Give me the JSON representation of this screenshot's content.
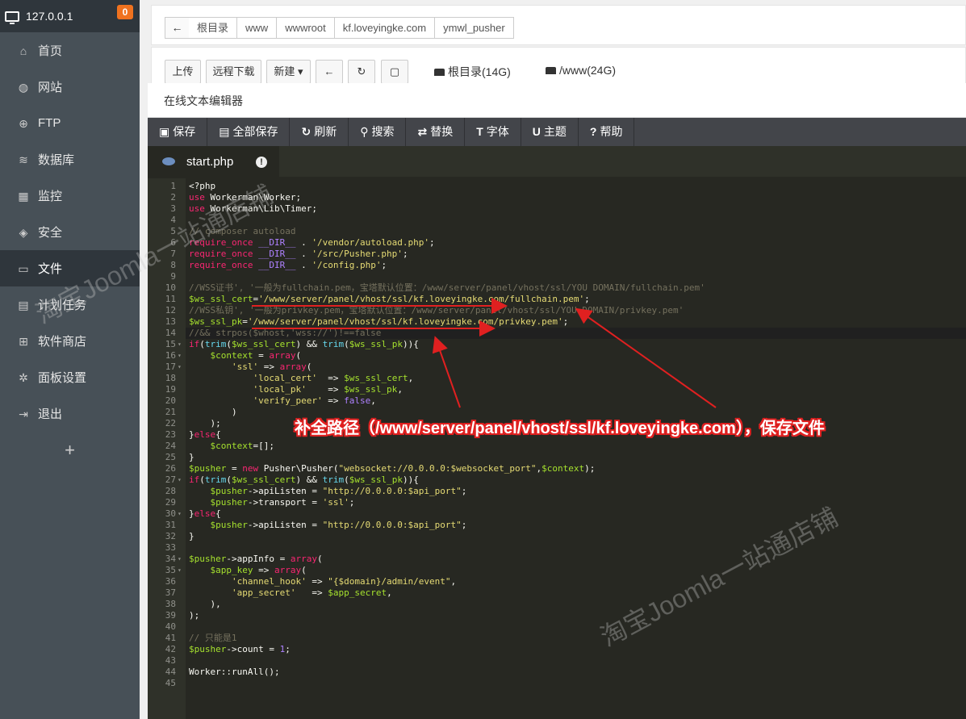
{
  "sidebar": {
    "host": "127.0.0.1",
    "badge": "0",
    "items": [
      {
        "label": "首页",
        "icon": "home-icon"
      },
      {
        "label": "网站",
        "icon": "globe-icon"
      },
      {
        "label": "FTP",
        "icon": "ftp-icon"
      },
      {
        "label": "数据库",
        "icon": "database-icon"
      },
      {
        "label": "监控",
        "icon": "monitor-chart-icon"
      },
      {
        "label": "安全",
        "icon": "shield-icon"
      },
      {
        "label": "文件",
        "icon": "folder-icon"
      },
      {
        "label": "计划任务",
        "icon": "calendar-icon"
      },
      {
        "label": "软件商店",
        "icon": "grid-icon"
      },
      {
        "label": "面板设置",
        "icon": "gear-icon"
      },
      {
        "label": "退出",
        "icon": "logout-icon"
      }
    ],
    "active_index": 6,
    "add": "+"
  },
  "breadcrumb": [
    "根目录",
    "www",
    "wwwroot",
    "kf.loveyingke.com",
    "ymwl_pusher"
  ],
  "toolbar": {
    "upload": "上传",
    "remote_download": "远程下载",
    "new": "新建",
    "disk_root": "根目录(14G)",
    "disk_www": "/www(24G)"
  },
  "editor": {
    "title": "在线文本编辑器",
    "tools": [
      "保存",
      "全部保存",
      "刷新",
      "搜索",
      "替换",
      "字体",
      "主题",
      "帮助"
    ],
    "tab": "start.php"
  },
  "annotation": {
    "note": "补全路径（/www/server/panel/vhost/ssl/kf.loveyingke.com），保存文件",
    "watermark": "淘宝Joomla一站通店铺"
  },
  "code_lines": [
    "<?php",
    "use Workerman\\Worker;",
    "use Workerman\\Lib\\Timer;",
    "",
    "// composer autoload",
    "require_once __DIR__ . '/vendor/autoload.php';",
    "require_once __DIR__ . '/src/Pusher.php';",
    "require_once __DIR__ . '/config.php';",
    "",
    "//WSS证书', '一般为fullchain.pem，宝塔默认位置：/www/server/panel/vhost/ssl/YOU DOMAIN/fullchain.pem'",
    "$ws_ssl_cert='/www/server/panel/vhost/ssl/kf.loveyingke.com/fullchain.pem';",
    "//WSS私钥', '一般为privkey.pem，宝塔默认位置：/www/server/panel/vhost/ssl/YOU DOMAIN/privkey.pem'",
    "$ws_ssl_pk='/www/server/panel/vhost/ssl/kf.loveyingke.com/privkey.pem';",
    "//&& strpos($whost,'wss://')!==false",
    "if(trim($ws_ssl_cert) && trim($ws_ssl_pk)){",
    "    $context = array(",
    "        'ssl' => array(",
    "            'local_cert'  => $ws_ssl_cert,",
    "            'local_pk'    => $ws_ssl_pk,",
    "            'verify_peer' => false,",
    "        )",
    "    );",
    "}else{",
    "    $context=[];",
    "}",
    "$pusher = new Pusher\\Pusher(\"websocket://0.0.0.0:$websocket_port\",$context);",
    "if(trim($ws_ssl_cert) && trim($ws_ssl_pk)){",
    "    $pusher->apiListen = \"http://0.0.0.0:$api_port\";",
    "    $pusher->transport = 'ssl';",
    "}else{",
    "    $pusher->apiListen = \"http://0.0.0.0:$api_port\";",
    "}",
    "",
    "$pusher->appInfo = array(",
    "    $app_key => array(",
    "        'channel_hook' => \"{$domain}/admin/event\",",
    "        'app_secret'   => $app_secret,",
    "    ),",
    ");",
    "",
    "// 只能是1",
    "$pusher->count = 1;",
    "",
    "Worker::runAll();",
    ""
  ],
  "fold_lines": [
    15,
    16,
    17,
    27,
    30,
    34,
    35
  ]
}
